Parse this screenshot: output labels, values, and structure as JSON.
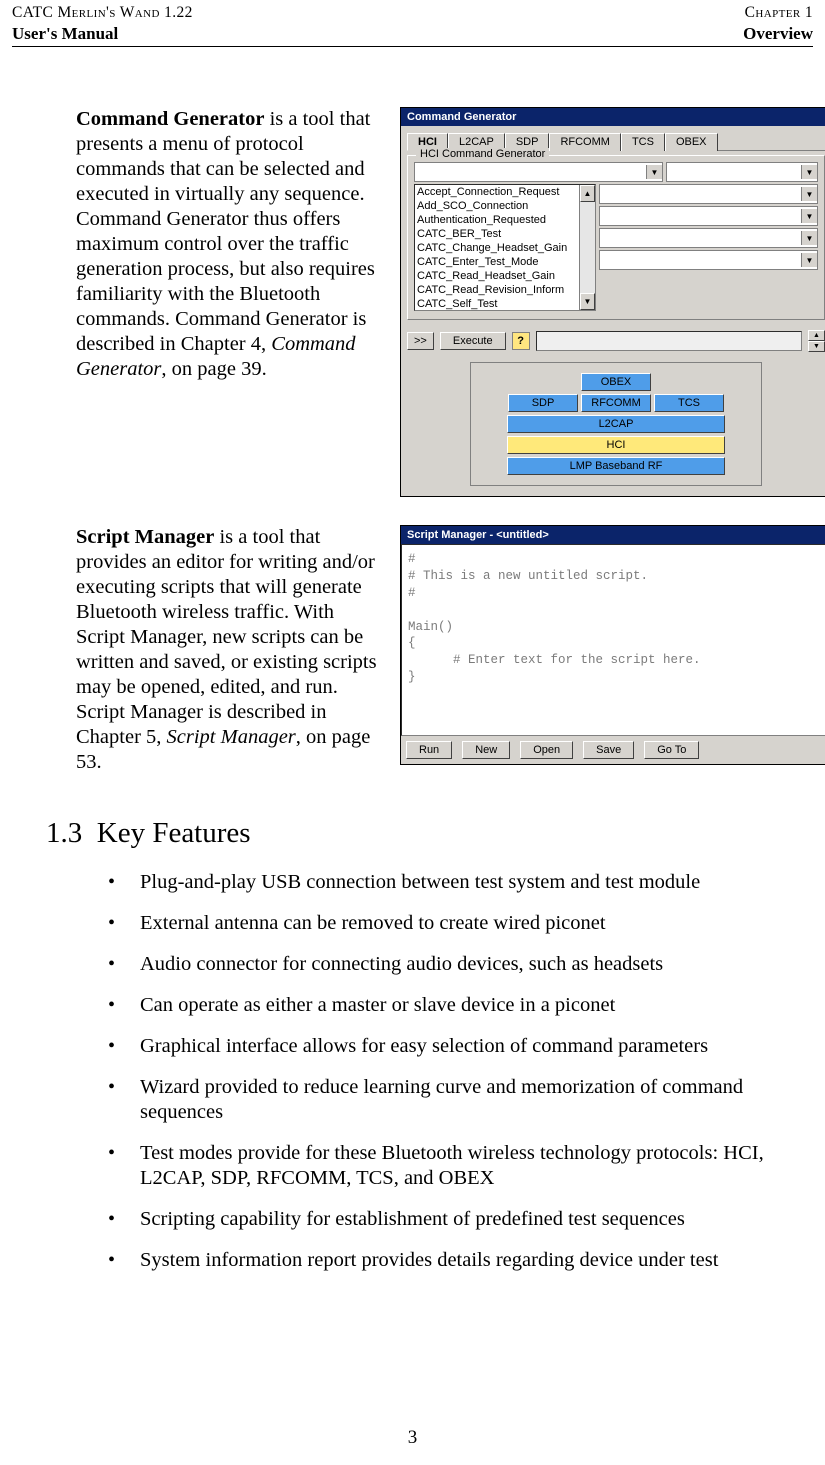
{
  "header": {
    "left_top": "CATC Merlin's Wand 1.22",
    "left_bottom": "User's Manual",
    "right_top": "Chapter 1",
    "right_bottom": "Overview"
  },
  "para1": {
    "strong": "Command Generator",
    "t1": " is a tool that presents a menu of protocol commands that can be selected and executed in virtually any sequence. Command Generator thus offers maximum control over the traffic generation process, but also requires familiarity with the Bluetooth commands. Command Generator is described in Chapter 4, ",
    "em": "Command Generator",
    "t2": ", on page 39."
  },
  "para2": {
    "strong": "Script Manager",
    "t1": " is a tool that provides an editor for writing and/or executing scripts that will generate Bluetooth wireless traffic. With Script Manager, new scripts can be written and saved, or existing scripts may be opened, edited, and run. Script Manager is described in Chapter 5, ",
    "em": "Script Manager",
    "t2": ", on page 53."
  },
  "fig1": {
    "title": "Command Generator",
    "tabs": [
      "HCI",
      "L2CAP",
      "SDP",
      "RFCOMM",
      "TCS",
      "OBEX"
    ],
    "group_label": "HCI Command Generator",
    "list_items": [
      "Accept_Connection_Request",
      "Add_SCO_Connection",
      "Authentication_Requested",
      "CATC_BER_Test",
      "CATC_Change_Headset_Gain",
      "CATC_Enter_Test_Mode",
      "CATC_Read_Headset_Gain",
      "CATC_Read_Revision_Inform",
      "CATC_Self_Test"
    ],
    "expand_btn": ">>",
    "execute_btn": "Execute",
    "help_icon_glyph": "?",
    "stack": {
      "obex": "OBEX",
      "sdp": "SDP",
      "rfcomm": "RFCOMM",
      "tcs": "TCS",
      "l2cap": "L2CAP",
      "hci": "HCI",
      "baseband": "LMP Baseband RF"
    }
  },
  "fig2": {
    "title": "Script Manager - <untitled>",
    "script_text": "#\n# This is a new untitled script.\n#\n\nMain()\n{\n      # Enter text for the script here.\n}",
    "buttons": [
      "Run",
      "New",
      "Open",
      "Save",
      "Go To"
    ]
  },
  "section": {
    "num": "1.3",
    "title": "Key Features"
  },
  "features": [
    "Plug-and-play USB connection between test system and test module",
    "External antenna can be removed to create wired piconet",
    "Audio connector for connecting audio devices, such as headsets",
    "Can operate as either a master or slave device in a piconet",
    "Graphical interface allows for easy selection of command parameters",
    "Wizard provided to reduce learning curve and memorization of command sequences",
    "Test modes provide for these Bluetooth wireless technology protocols: HCI, L2CAP, SDP, RFCOMM, TCS, and OBEX",
    "Scripting capability for establishment of predefined test sequences",
    "System information report provides details regarding device under test"
  ],
  "pagenum": "3"
}
